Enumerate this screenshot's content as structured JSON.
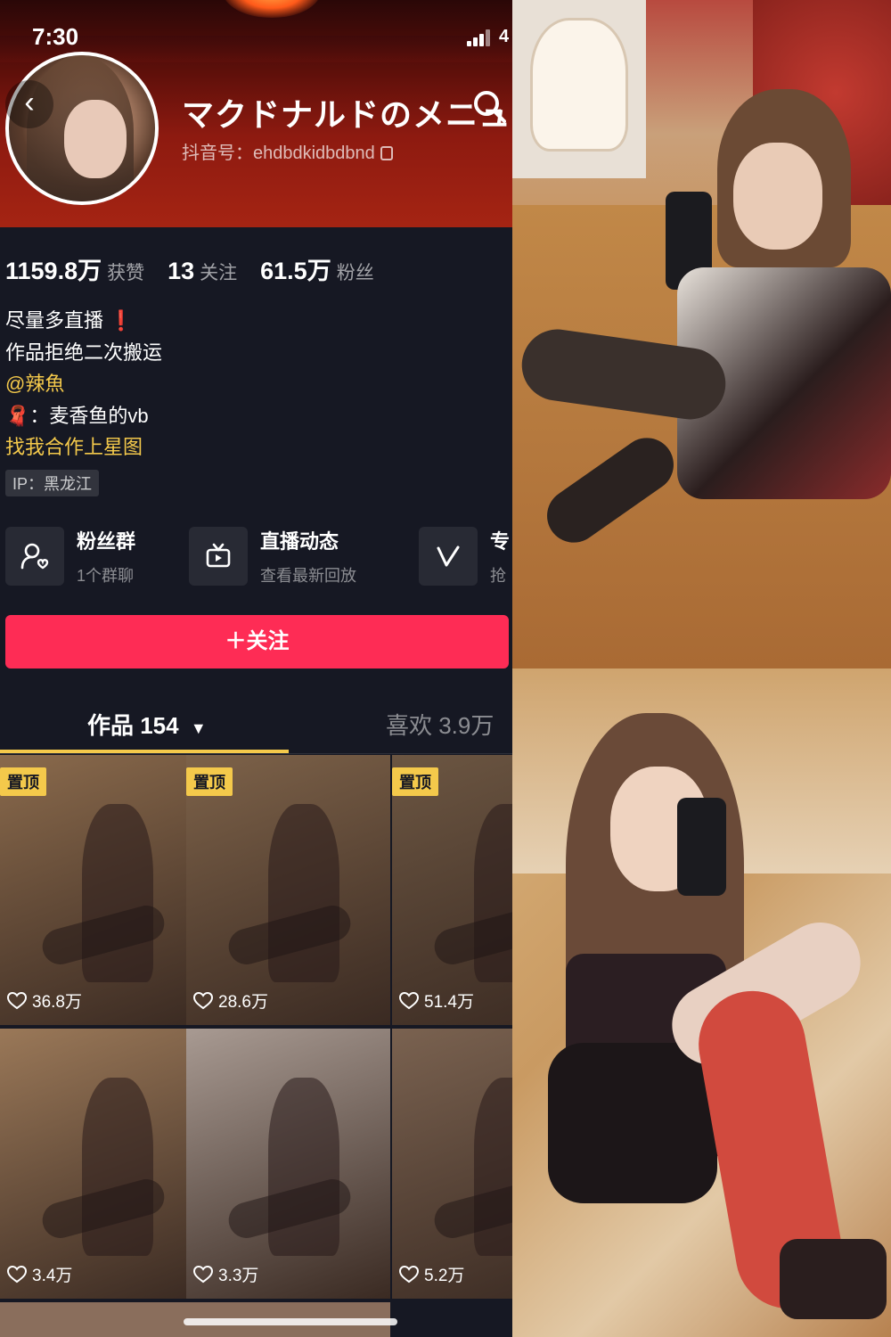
{
  "status_bar": {
    "time": "7:30",
    "battery": "4"
  },
  "profile": {
    "name": "マクドナルドのメニュ",
    "douyin_id": "抖音号：ehdbdkidbdbnd",
    "stats": [
      {
        "num": "1159.8万",
        "label": "获赞"
      },
      {
        "num": "13",
        "label": "关注"
      },
      {
        "num": "61.5万",
        "label": "粉丝"
      }
    ],
    "bio": {
      "line1": "尽量多直播",
      "line1_mark": "❗",
      "line2": "作品拒绝二次搬运",
      "line3": "@辣魚",
      "line4_emoji": "🧣",
      "line4": "：麦香鱼的vb",
      "line5": "找我合作上星图"
    },
    "ip": "IP：黑龙江"
  },
  "services": [
    {
      "title": "粉丝群",
      "subtitle": "1个群聊",
      "icon": "fan-group-icon"
    },
    {
      "title": "直播动态",
      "subtitle": "查看最新回放",
      "icon": "live-tv-icon"
    },
    {
      "title": "专",
      "subtitle": "抢",
      "icon": "v-icon"
    }
  ],
  "follow_button": "＋关注",
  "tabs": {
    "works": "作品 154",
    "likes": "喜欢 3.9万"
  },
  "videos": [
    {
      "pinned": true,
      "pin_label": "置顶",
      "likes": "36.8万",
      "bg": "#8a6a4c"
    },
    {
      "pinned": true,
      "pin_label": "置顶",
      "likes": "28.6万",
      "bg": "#7d6249"
    },
    {
      "pinned": true,
      "pin_label": "置顶",
      "likes": "51.4万",
      "bg": "#6c5642"
    },
    {
      "pinned": false,
      "pin_label": "",
      "likes": "3.4万",
      "bg": "#9a7858"
    },
    {
      "pinned": false,
      "pin_label": "",
      "likes": "3.3万",
      "bg": "#a89a92"
    },
    {
      "pinned": false,
      "pin_label": "",
      "likes": "5.2万",
      "bg": "#7a6250"
    }
  ],
  "colors": {
    "accent": "#fe2c55",
    "highlight": "#f4c94b",
    "background": "#161823"
  }
}
